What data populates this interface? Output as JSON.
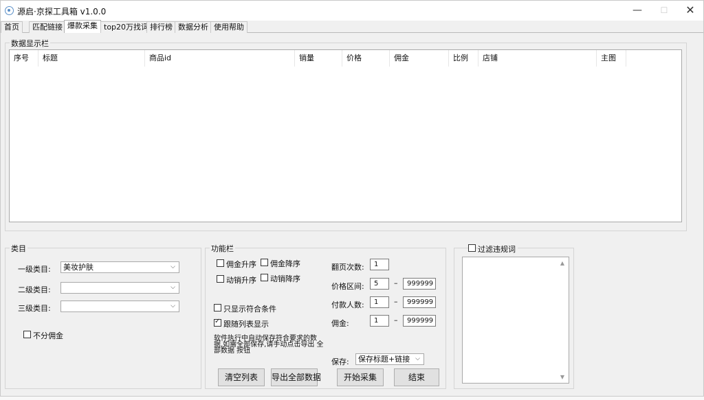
{
  "window": {
    "title": "源启·京探工具箱 v1.0.0",
    "minimize_glyph": "—",
    "maximize_glyph": "☐",
    "close_glyph": "✕"
  },
  "tabs": [
    {
      "label": "首页"
    },
    {
      "label": "匹配链接"
    },
    {
      "label": "爆款采集",
      "active": true
    },
    {
      "label": "top20万找词"
    },
    {
      "label": "排行榜"
    },
    {
      "label": "数据分析"
    },
    {
      "label": "使用帮助"
    }
  ],
  "data_panel": {
    "title": "数据显示栏",
    "columns": [
      "序号",
      "标题",
      "商品id",
      "销量",
      "价格",
      "佣金",
      "比例",
      "店铺",
      "主图"
    ],
    "rows": []
  },
  "category": {
    "title": "类目",
    "level1_label": "一级类目:",
    "level1_value": "美妆护肤",
    "level2_label": "二级类目:",
    "level2_value": "",
    "level3_label": "三级类目:",
    "level3_value": "",
    "no_commission_label": "不分佣金",
    "no_commission_checked": false
  },
  "functions": {
    "title": "功能栏",
    "commission_asc": "佣金升序",
    "commission_desc": "佣金降序",
    "sales_asc": "动销升序",
    "sales_desc": "动销降序",
    "only_matching": "只显示符合条件",
    "only_matching_checked": false,
    "follow_list": "跟随列表显示",
    "follow_list_checked": true,
    "note": "软件执行中自动保存符合要求的数据,如需全部保存,请手动点击导出 全部数据 按钮",
    "pages_label": "翻页次数:",
    "pages_value": "1",
    "price_label": "价格区间:",
    "price_min": "5",
    "price_max": "999999",
    "buyers_label": "付款人数:",
    "buyers_min": "1",
    "buyers_max": "999999",
    "commission_label": "佣金:",
    "commission_min": "1",
    "commission_max": "999999",
    "range_sep": "–",
    "save_label": "保存:",
    "save_value": "保存标题+链接",
    "clear_button": "清空列表",
    "export_button": "导出全部数据",
    "start_button": "开始采集",
    "end_button": "结束"
  },
  "filter": {
    "label": "过滤违规词",
    "checked": false,
    "text": ""
  },
  "icons": {
    "dropdown": "⌵",
    "scroll_up": "▲",
    "scroll_down": "▼"
  }
}
